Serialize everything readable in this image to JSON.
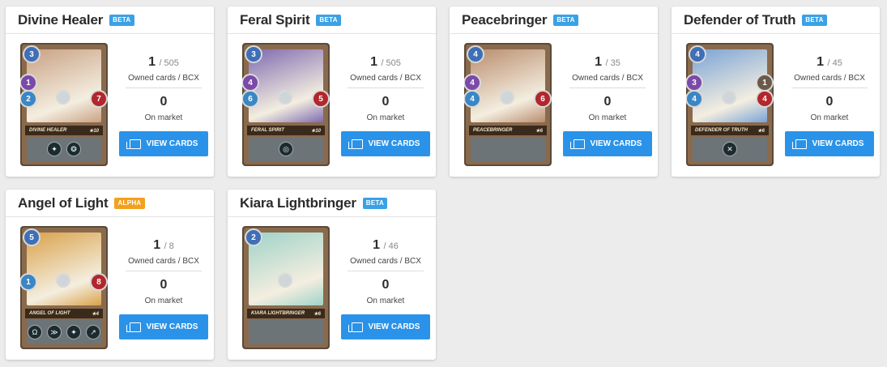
{
  "cards": [
    {
      "title": "Divine Healer",
      "badge": "BETA",
      "badge_color": "#3aa1e5",
      "owned": "1",
      "total": "/ 505",
      "owned_label": "Owned cards / BCX",
      "market": "0",
      "market_label": "On market",
      "button": "VIEW CARDS",
      "art": {
        "name": "DIVINE HEALER",
        "stars": "★10",
        "mana": "3",
        "melee": "1",
        "speed": "2",
        "health": "7",
        "armor": "",
        "pic": "#c9a184",
        "abilities": [
          "✦",
          "❂"
        ]
      }
    },
    {
      "title": "Feral Spirit",
      "badge": "BETA",
      "badge_color": "#3aa1e5",
      "owned": "1",
      "total": "/ 505",
      "owned_label": "Owned cards / BCX",
      "market": "0",
      "market_label": "On market",
      "button": "VIEW CARDS",
      "art": {
        "name": "FERAL SPIRIT",
        "stars": "★10",
        "mana": "3",
        "melee": "4",
        "speed": "6",
        "health": "5",
        "armor": "",
        "pic": "#7e6bb0",
        "abilities": [
          "◎"
        ]
      }
    },
    {
      "title": "Peacebringer",
      "badge": "BETA",
      "badge_color": "#3aa1e5",
      "owned": "1",
      "total": "/ 35",
      "owned_label": "Owned cards / BCX",
      "market": "0",
      "market_label": "On market",
      "button": "VIEW CARDS",
      "art": {
        "name": "PEACEBRINGER",
        "stars": "★6",
        "mana": "4",
        "melee": "4",
        "speed": "4",
        "health": "6",
        "armor": "",
        "pic": "#b98d6e",
        "abilities": []
      }
    },
    {
      "title": "Defender of Truth",
      "badge": "BETA",
      "badge_color": "#3aa1e5",
      "owned": "1",
      "total": "/ 45",
      "owned_label": "Owned cards / BCX",
      "market": "0",
      "market_label": "On market",
      "button": "VIEW CARDS",
      "art": {
        "name": "DEFENDER OF TRUTH",
        "stars": "★6",
        "mana": "4",
        "melee": "3",
        "speed": "4",
        "health": "4",
        "armor": "1",
        "pic": "#7aa3d6",
        "abilities": [
          "✕"
        ]
      }
    },
    {
      "title": "Angel of Light",
      "badge": "ALPHA",
      "badge_color": "#f2a11d",
      "owned": "1",
      "total": "/ 8",
      "owned_label": "Owned cards / BCX",
      "market": "0",
      "market_label": "On market",
      "button": "VIEW CARDS",
      "art": {
        "name": "ANGEL OF LIGHT",
        "stars": "★4",
        "mana": "5",
        "melee": "",
        "speed": "1",
        "health": "8",
        "armor": "",
        "pic": "#d9a24a",
        "abilities": [
          "Ω",
          "≫",
          "✦",
          "↗"
        ]
      }
    },
    {
      "title": "Kiara Lightbringer",
      "badge": "BETA",
      "badge_color": "#3aa1e5",
      "owned": "1",
      "total": "/ 46",
      "owned_label": "Owned cards / BCX",
      "market": "0",
      "market_label": "On market",
      "button": "VIEW CARDS",
      "art": {
        "name": "KIARA LIGHTBRINGER",
        "stars": "★6",
        "mana": "2",
        "melee": "",
        "speed": "",
        "health": "",
        "armor": "",
        "pic": "#9fd3c8",
        "abilities": []
      }
    }
  ]
}
